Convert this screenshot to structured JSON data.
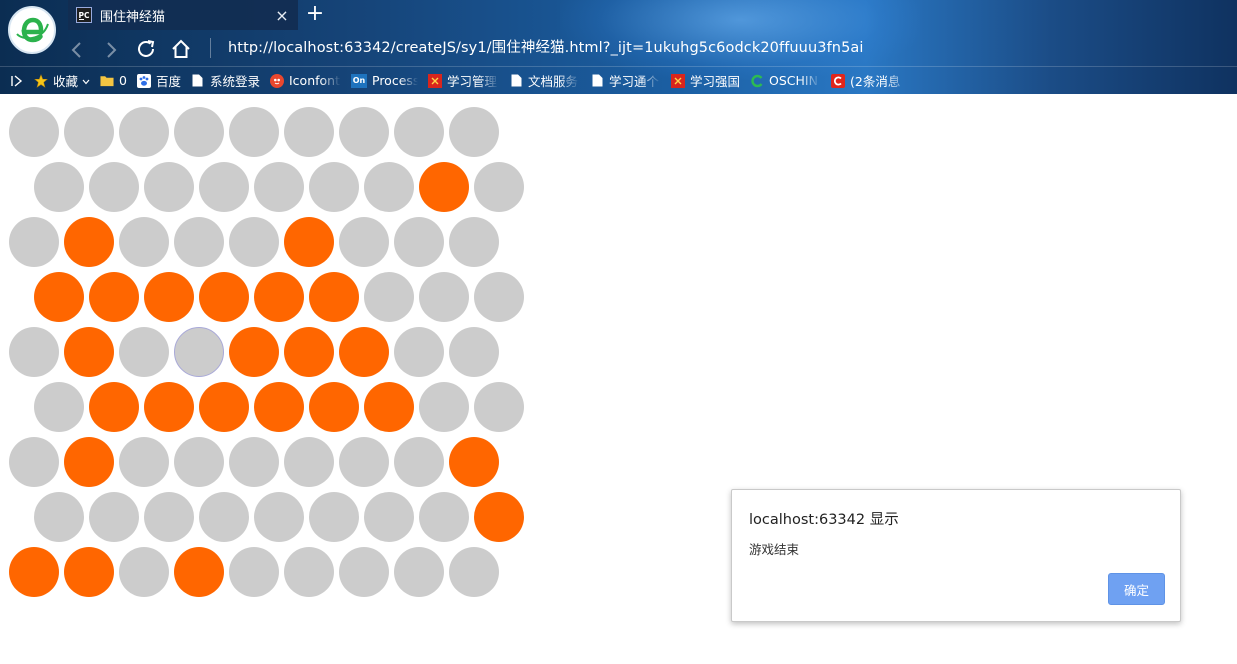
{
  "browser": {
    "tab_title": "围住神经猫",
    "tab_close": "×",
    "new_tab": "+",
    "url": "http://localhost:63342/createJS/sy1/围住神经猫.html?_ijt=1ukuhg5c6odck20ffuuu3fn5ai",
    "bookmarks": [
      {
        "label": "收藏",
        "icon": "star-icon"
      },
      {
        "label": "0",
        "icon": "folder-icon"
      },
      {
        "label": "百度",
        "icon": "baidu-paw-icon"
      },
      {
        "label": "系统登录",
        "icon": "page-icon"
      },
      {
        "label": "Iconfont",
        "icon": "iconfont-icon"
      },
      {
        "label": "Process",
        "icon": "processon-icon"
      },
      {
        "label": "学习管理",
        "icon": "red-badge-icon"
      },
      {
        "label": "文档服务",
        "icon": "page-icon"
      },
      {
        "label": "学习通个",
        "icon": "page-icon"
      },
      {
        "label": "学习强国",
        "icon": "red-badge-icon"
      },
      {
        "label": "OSCHIN",
        "icon": "oschina-icon"
      },
      {
        "label": "(2条消息",
        "icon": "csdn-icon"
      }
    ]
  },
  "board": {
    "rows": [
      [
        0,
        0,
        0,
        0,
        0,
        0,
        0,
        0,
        0
      ],
      [
        0,
        0,
        0,
        0,
        0,
        0,
        0,
        1,
        0
      ],
      [
        0,
        1,
        0,
        0,
        0,
        1,
        0,
        0,
        0
      ],
      [
        1,
        1,
        1,
        1,
        1,
        1,
        0,
        0,
        0
      ],
      [
        0,
        1,
        0,
        2,
        1,
        1,
        1,
        0,
        0
      ],
      [
        0,
        1,
        1,
        1,
        1,
        1,
        1,
        0,
        0
      ],
      [
        0,
        1,
        0,
        0,
        0,
        0,
        0,
        0,
        1
      ],
      [
        0,
        0,
        0,
        0,
        0,
        0,
        0,
        0,
        1
      ],
      [
        1,
        1,
        0,
        1,
        0,
        0,
        0,
        0,
        0
      ]
    ],
    "colors": {
      "empty": "#cccccc",
      "blocked": "#ff6600"
    }
  },
  "dialog": {
    "title": "localhost:63342 显示",
    "message": "游戏结束",
    "ok_label": "确定"
  }
}
